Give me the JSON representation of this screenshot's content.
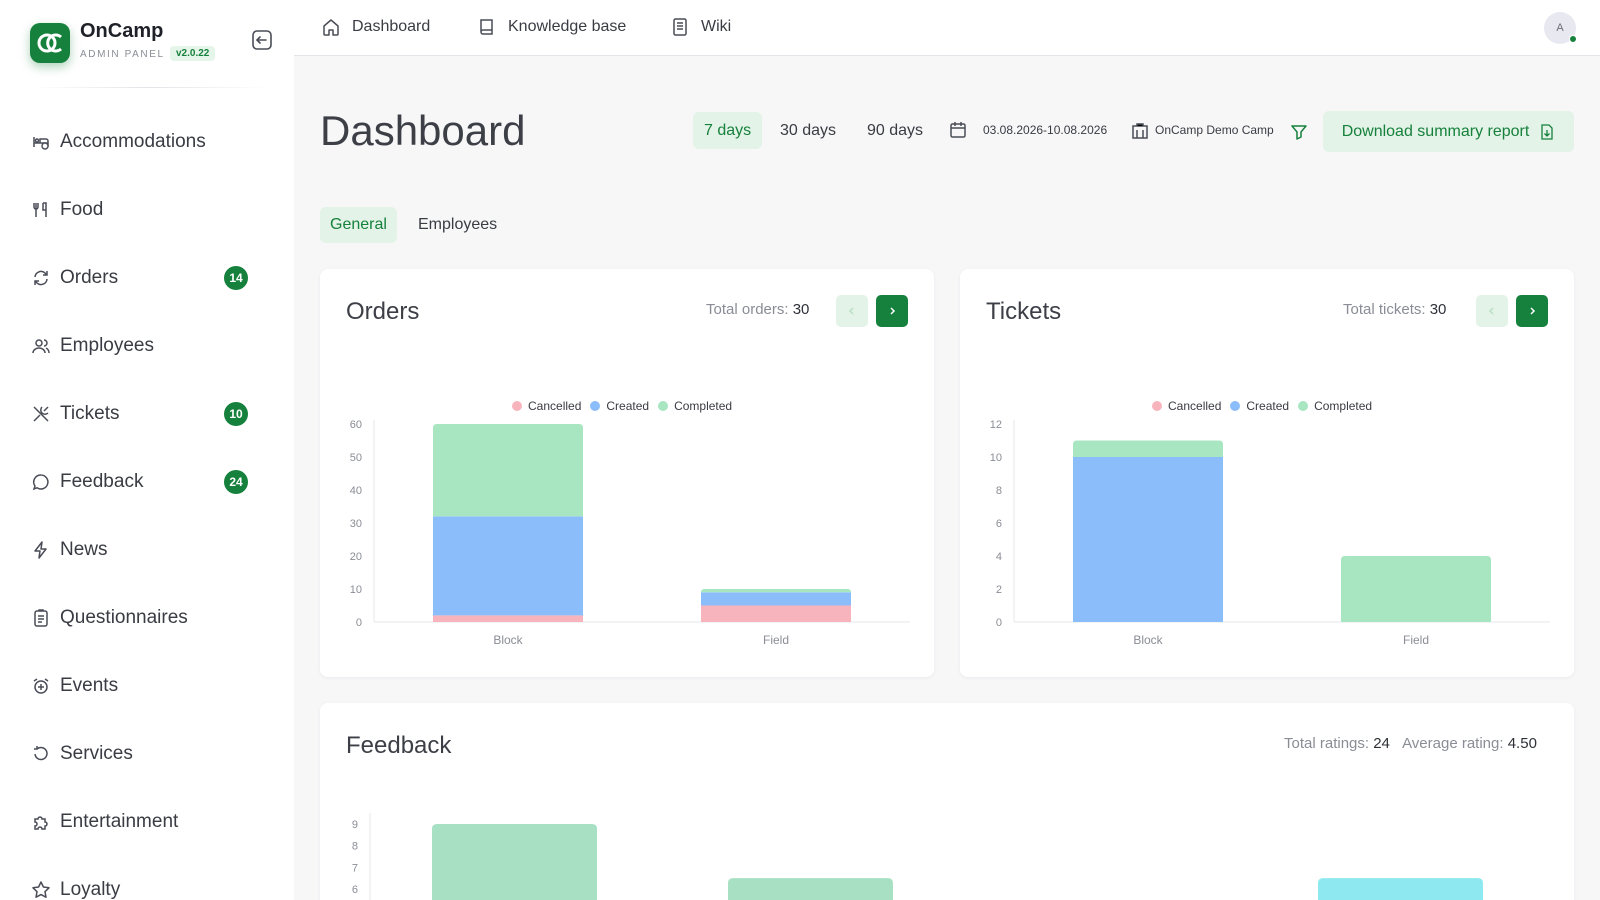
{
  "brand": {
    "name": "OnCamp",
    "subtitle": "ADMIN PANEL",
    "version": "v2.0.22"
  },
  "sidebar": {
    "items": [
      {
        "label": "Accommodations",
        "icon": "bed-icon"
      },
      {
        "label": "Food",
        "icon": "utensils-icon"
      },
      {
        "label": "Orders",
        "icon": "refresh-icon",
        "badge": "14"
      },
      {
        "label": "Employees",
        "icon": "users-icon"
      },
      {
        "label": "Tickets",
        "icon": "tools-icon",
        "badge": "10"
      },
      {
        "label": "Feedback",
        "icon": "chat-bubble-icon",
        "badge": "24"
      },
      {
        "label": "News",
        "icon": "lightning-icon"
      },
      {
        "label": "Questionnaires",
        "icon": "clipboard-icon"
      },
      {
        "label": "Events",
        "icon": "alarm-plus-icon"
      },
      {
        "label": "Services",
        "icon": "rotate-icon"
      },
      {
        "label": "Entertainment",
        "icon": "puzzle-icon"
      },
      {
        "label": "Loyalty",
        "icon": "star-icon"
      }
    ]
  },
  "topbar": {
    "links": [
      {
        "label": "Dashboard",
        "icon": "home-icon"
      },
      {
        "label": "Knowledge base",
        "icon": "book-icon"
      },
      {
        "label": "Wiki",
        "icon": "document-icon"
      }
    ],
    "avatar_initial": "A"
  },
  "header": {
    "title": "Dashboard",
    "ranges": [
      "7 days",
      "30 days",
      "90 days"
    ],
    "active_range": "7 days",
    "date_range": "03.08.2026-10.08.2026",
    "camp": "OnCamp Demo Camp",
    "download_label": "Download summary report"
  },
  "tabs": [
    "General",
    "Employees"
  ],
  "active_tab": "General",
  "colors": {
    "accent": "#16813c",
    "accent_light": "#e3f3e7",
    "cancelled": "#f8b4bc",
    "created": "#8cbdfb",
    "completed": "#a8e6c1"
  },
  "orders": {
    "title": "Orders",
    "total_label": "Total orders:",
    "total_value": "30"
  },
  "tickets": {
    "title": "Tickets",
    "total_label": "Total tickets:",
    "total_value": "30"
  },
  "feedback": {
    "title": "Feedback",
    "total_label": "Total ratings:",
    "total_value": "24",
    "avg_label": "Average rating:",
    "avg_value": "4.50"
  },
  "chart_data": [
    {
      "type": "bar",
      "stacked": true,
      "title": "Orders",
      "categories": [
        "Block",
        "Field"
      ],
      "series": [
        {
          "name": "Cancelled",
          "values": [
            2,
            5
          ],
          "color": "#f8b4bc"
        },
        {
          "name": "Created",
          "values": [
            30,
            4
          ],
          "color": "#8cbdfb"
        },
        {
          "name": "Completed",
          "values": [
            28,
            1
          ],
          "color": "#a8e6c1"
        }
      ],
      "ylim": [
        0,
        60
      ],
      "yticks": [
        0,
        10,
        20,
        30,
        40,
        50,
        60
      ],
      "legend": "top-center",
      "grid": false
    },
    {
      "type": "bar",
      "stacked": true,
      "title": "Tickets",
      "categories": [
        "Block",
        "Field"
      ],
      "series": [
        {
          "name": "Cancelled",
          "values": [
            0,
            0
          ],
          "color": "#f8b4bc"
        },
        {
          "name": "Created",
          "values": [
            10,
            0
          ],
          "color": "#8cbdfb"
        },
        {
          "name": "Completed",
          "values": [
            1,
            4
          ],
          "color": "#a8e6c1"
        }
      ],
      "ylim": [
        0,
        12
      ],
      "yticks": [
        0,
        2,
        4,
        6,
        8,
        10,
        12
      ],
      "legend": "top-center",
      "grid": false
    },
    {
      "type": "bar",
      "title": "Feedback",
      "yticks_visible": [
        6,
        7,
        8,
        9
      ],
      "bars": [
        {
          "value": 9,
          "color": "#a8e0c4"
        },
        {
          "value": 6.5,
          "color": "#a8e0c4"
        },
        {
          "value": 6.5,
          "color": "#8de8f0"
        }
      ],
      "grid": false
    }
  ]
}
